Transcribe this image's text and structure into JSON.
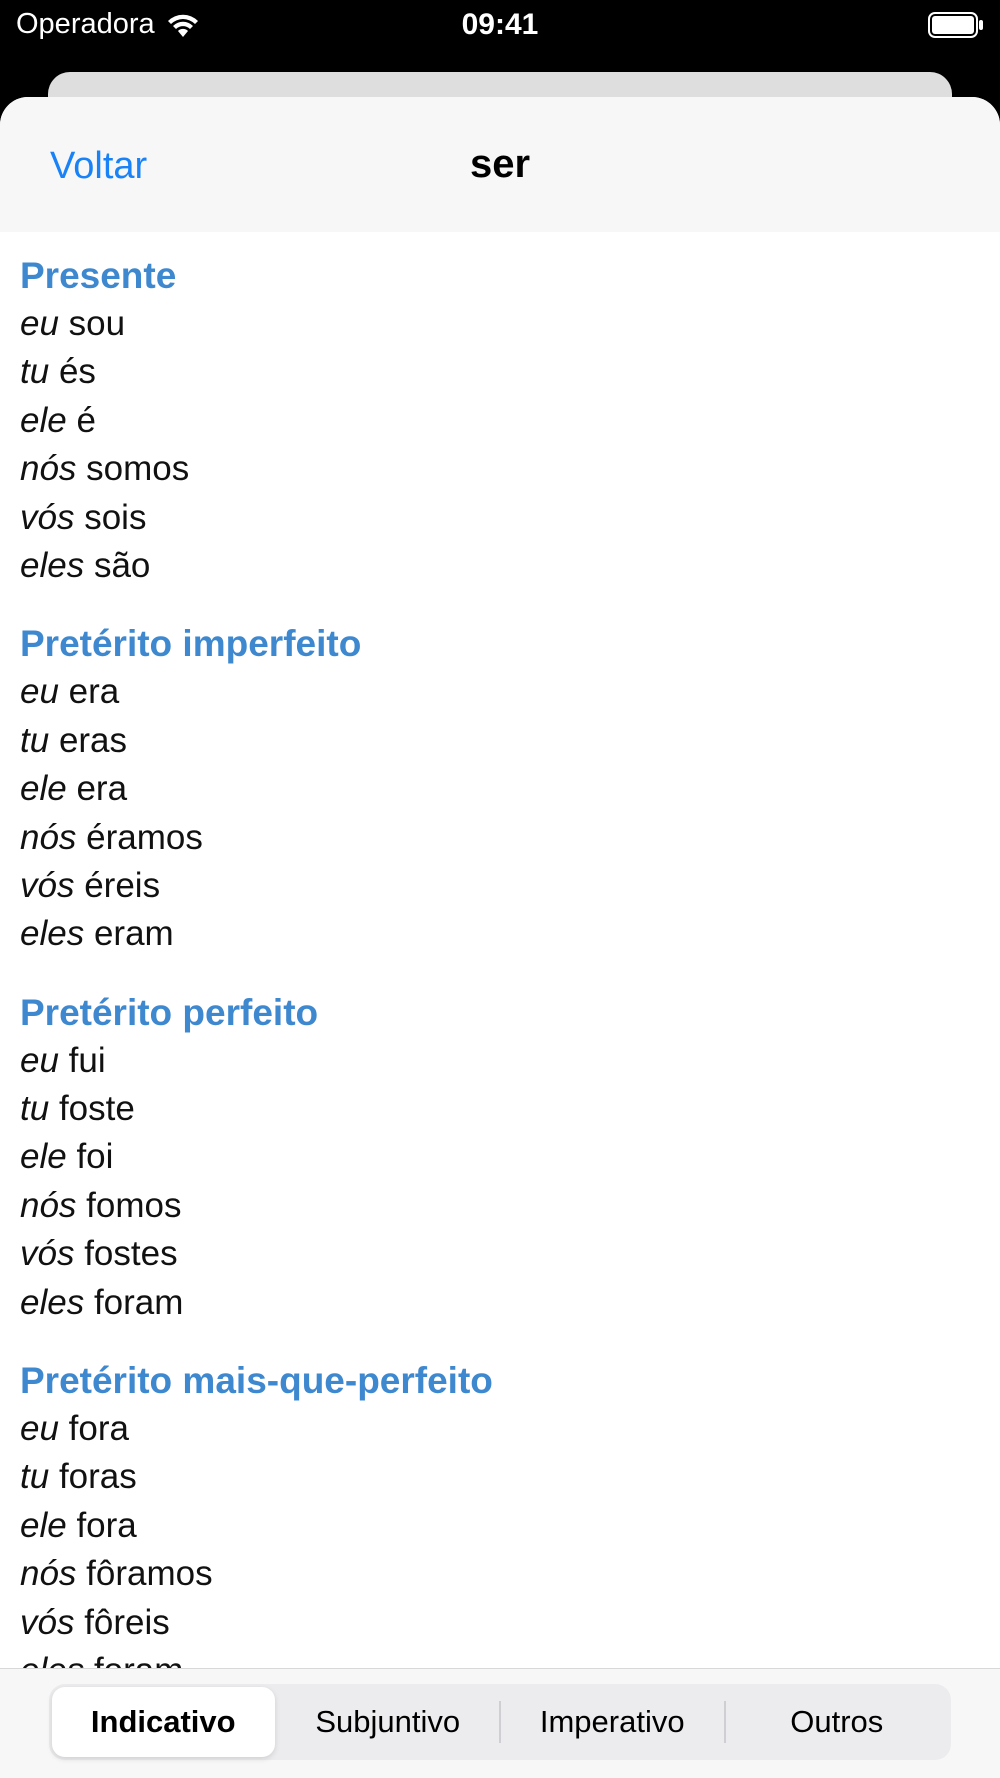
{
  "status_bar": {
    "carrier": "Operadora",
    "time": "09:41"
  },
  "nav": {
    "back_label": "Voltar",
    "title": "ser"
  },
  "tenses": [
    {
      "title": "Presente",
      "forms": [
        {
          "pronoun": "eu",
          "form": "sou"
        },
        {
          "pronoun": "tu",
          "form": "és"
        },
        {
          "pronoun": "ele",
          "form": "é"
        },
        {
          "pronoun": "nós",
          "form": "somos"
        },
        {
          "pronoun": "vós",
          "form": "sois"
        },
        {
          "pronoun": "eles",
          "form": "são"
        }
      ]
    },
    {
      "title": "Pretérito imperfeito",
      "forms": [
        {
          "pronoun": "eu",
          "form": "era"
        },
        {
          "pronoun": "tu",
          "form": "eras"
        },
        {
          "pronoun": "ele",
          "form": "era"
        },
        {
          "pronoun": "nós",
          "form": "éramos"
        },
        {
          "pronoun": "vós",
          "form": "éreis"
        },
        {
          "pronoun": "eles",
          "form": "eram"
        }
      ]
    },
    {
      "title": "Pretérito perfeito",
      "forms": [
        {
          "pronoun": "eu",
          "form": "fui"
        },
        {
          "pronoun": "tu",
          "form": "foste"
        },
        {
          "pronoun": "ele",
          "form": "foi"
        },
        {
          "pronoun": "nós",
          "form": "fomos"
        },
        {
          "pronoun": "vós",
          "form": "fostes"
        },
        {
          "pronoun": "eles",
          "form": "foram"
        }
      ]
    },
    {
      "title": "Pretérito mais-que-perfeito",
      "forms": [
        {
          "pronoun": "eu",
          "form": "fora"
        },
        {
          "pronoun": "tu",
          "form": "foras"
        },
        {
          "pronoun": "ele",
          "form": "fora"
        },
        {
          "pronoun": "nós",
          "form": "fôramos"
        },
        {
          "pronoun": "vós",
          "form": "fôreis"
        },
        {
          "pronoun": "eles",
          "form": "foram"
        }
      ]
    }
  ],
  "segments": {
    "items": [
      "Indicativo",
      "Subjuntivo",
      "Imperativo",
      "Outros"
    ],
    "selected": "Indicativo"
  },
  "colors": {
    "accent": "#1a82f7",
    "tense_title": "#3d88cf"
  }
}
